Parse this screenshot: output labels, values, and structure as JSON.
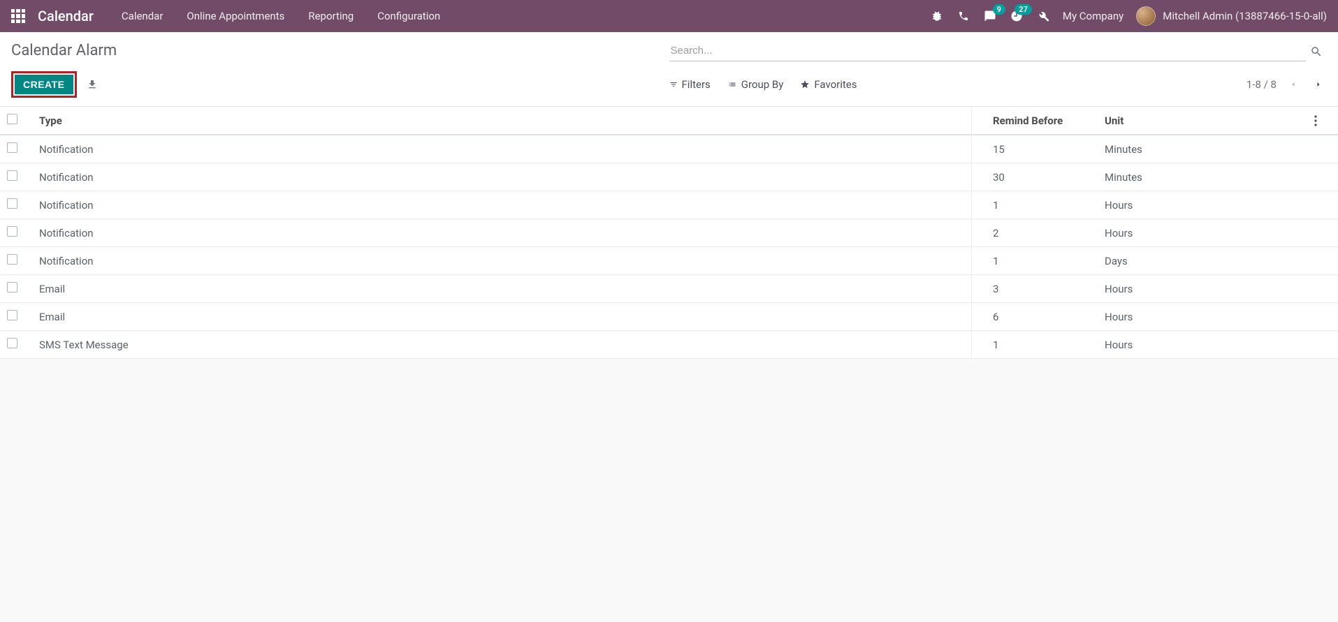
{
  "navbar": {
    "brand": "Calendar",
    "menu": [
      "Calendar",
      "Online Appointments",
      "Reporting",
      "Configuration"
    ],
    "badges": {
      "messages": "9",
      "activities": "27"
    },
    "company": "My Company",
    "user": "Mitchell Admin (13887466-15-0-all)"
  },
  "control": {
    "title": "Calendar Alarm",
    "create_label": "CREATE",
    "search_placeholder": "Search...",
    "filters_label": "Filters",
    "groupby_label": "Group By",
    "favorites_label": "Favorites",
    "pager": "1-8 / 8"
  },
  "table": {
    "headers": {
      "type": "Type",
      "remind": "Remind Before",
      "unit": "Unit"
    },
    "rows": [
      {
        "type": "Notification",
        "remind": "15",
        "unit": "Minutes"
      },
      {
        "type": "Notification",
        "remind": "30",
        "unit": "Minutes"
      },
      {
        "type": "Notification",
        "remind": "1",
        "unit": "Hours"
      },
      {
        "type": "Notification",
        "remind": "2",
        "unit": "Hours"
      },
      {
        "type": "Notification",
        "remind": "1",
        "unit": "Days"
      },
      {
        "type": "Email",
        "remind": "3",
        "unit": "Hours"
      },
      {
        "type": "Email",
        "remind": "6",
        "unit": "Hours"
      },
      {
        "type": "SMS Text Message",
        "remind": "1",
        "unit": "Hours"
      }
    ]
  }
}
